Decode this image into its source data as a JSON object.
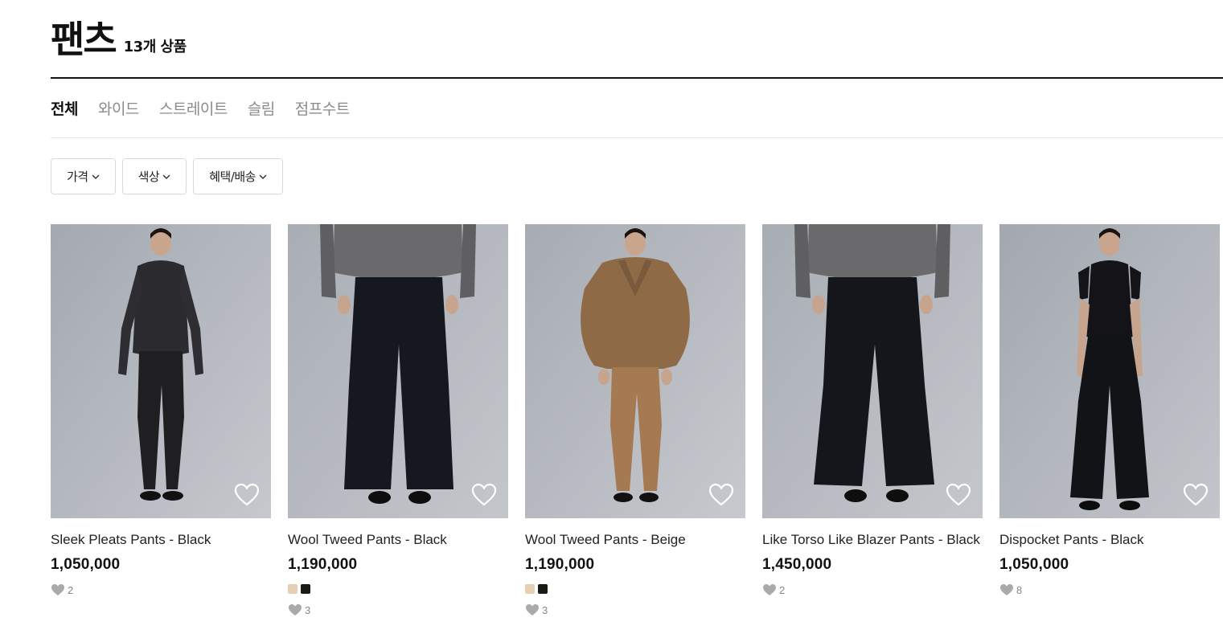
{
  "header": {
    "title": "팬츠",
    "count": "13개 상품"
  },
  "tabs": [
    {
      "label": "전체",
      "active": true
    },
    {
      "label": "와이드",
      "active": false
    },
    {
      "label": "스트레이트",
      "active": false
    },
    {
      "label": "슬림",
      "active": false
    },
    {
      "label": "점프수트",
      "active": false
    }
  ],
  "filters": [
    {
      "label": "가격"
    },
    {
      "label": "색상"
    },
    {
      "label": "혜택/배송"
    }
  ],
  "products": [
    {
      "name": "Sleek Pleats Pants - Black",
      "price": "1,050,000",
      "likes": "2",
      "swatches": [],
      "image": "full-body-model-black-pleats"
    },
    {
      "name": "Wool Tweed Pants - Black",
      "price": "1,190,000",
      "likes": "3",
      "swatches": [
        "#e7cfb4",
        "#1a1a14"
      ],
      "image": "lower-body-black-wide-pants"
    },
    {
      "name": "Wool Tweed Pants - Beige",
      "price": "1,190,000",
      "likes": "3",
      "swatches": [
        "#e7cfb4",
        "#1a1a14"
      ],
      "image": "full-body-model-beige-suit"
    },
    {
      "name": "Like Torso Like Blazer Pants - Black",
      "price": "1,450,000",
      "likes": "2",
      "swatches": [],
      "image": "lower-body-black-wide-pants"
    },
    {
      "name": "Dispocket Pants - Black",
      "price": "1,050,000",
      "likes": "8",
      "swatches": [],
      "image": "full-body-model-black-wide"
    }
  ],
  "colors": {
    "text_primary": "#111111",
    "tab_inactive": "#8a8a8a",
    "photo_bg": "#a9aeb5",
    "like_icon": "#aaaaaa"
  }
}
